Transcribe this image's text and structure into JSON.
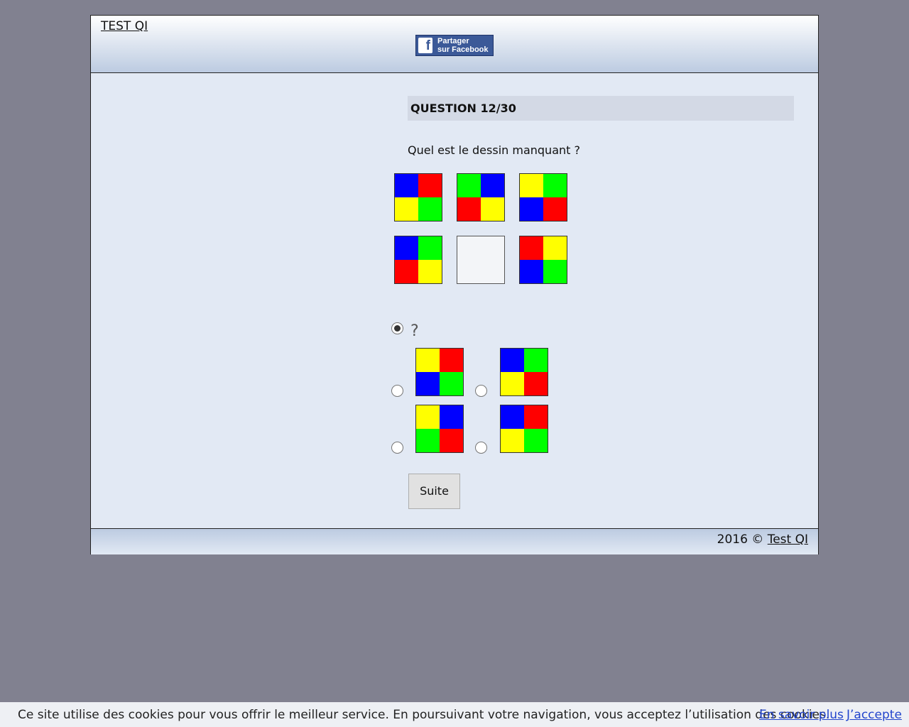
{
  "header": {
    "site_title": "TEST QI",
    "facebook_line1": "Partager",
    "facebook_line2": "sur Facebook"
  },
  "question": {
    "heading": "QUESTION 12/30",
    "prompt": "Quel est le dessin manquant ?"
  },
  "colors": {
    "B": "#0000ff",
    "R": "#ff0000",
    "Y": "#ffff00",
    "G": "#00ff00"
  },
  "puzzle_grid": [
    [
      "B",
      "R",
      "Y",
      "G"
    ],
    [
      "G",
      "B",
      "R",
      "Y"
    ],
    [
      "Y",
      "G",
      "B",
      "R"
    ],
    [
      "B",
      "G",
      "R",
      "Y"
    ],
    null,
    [
      "R",
      "Y",
      "B",
      "G"
    ]
  ],
  "answers": {
    "placeholder_label": "?",
    "placeholder_selected": true,
    "options": [
      [
        "Y",
        "R",
        "B",
        "G"
      ],
      [
        "B",
        "G",
        "Y",
        "R"
      ],
      [
        "Y",
        "B",
        "G",
        "R"
      ],
      [
        "B",
        "R",
        "Y",
        "G"
      ]
    ]
  },
  "submit_label": "Suite",
  "footer": {
    "copyright": "2016 ©",
    "link": "Test QI"
  },
  "cookie_bar": {
    "message": "Ce site utilise des cookies pour vous offrir le meilleur service. En poursuivant votre navigation, vous acceptez l’utilisation des cookies.",
    "more_link": "En savoir plus",
    "accept_link": "J’accepte"
  }
}
